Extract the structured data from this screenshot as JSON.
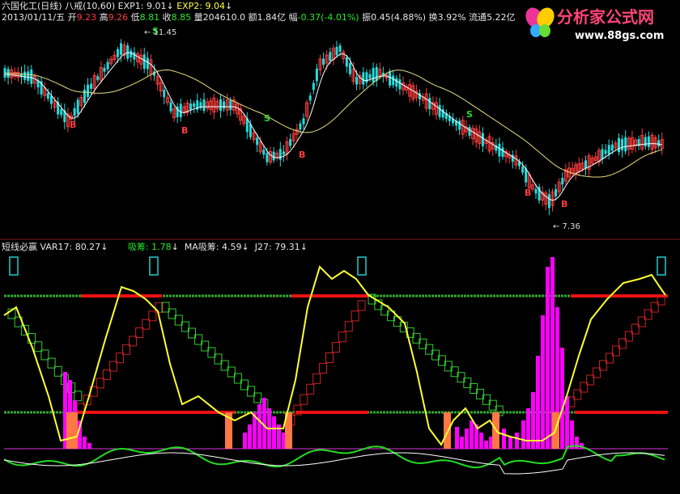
{
  "header": {
    "title": "六国化工(日线) 八戒(10,60)",
    "exp1_label": "EXP1: 9.01",
    "exp2_label": "EXP2: 9.04",
    "date": "2013/01/11/五",
    "open_label": "开",
    "open": "9.23",
    "high_label": "高",
    "high": "9.26",
    "low_label": "低",
    "low": "8.81",
    "close_label": "收",
    "close": "8.85",
    "vol_label": "量",
    "vol": "204610.0",
    "amount_label": "额",
    "amount": "1.84亿",
    "change_label": "幅",
    "change": "-0.37(-4.01%)",
    "amp_label": "振",
    "amp": "0.45(4.88%)",
    "turnover_label": "换",
    "turnover": "3.92%",
    "float_label": "流通",
    "float": "5.22亿"
  },
  "indicator": {
    "name": "短线必赢",
    "var17": "VAR17: 80.27",
    "xichou": "吸筹: 1.78",
    "ma_xichou": "MA吸筹: 4.59",
    "j27": "J27: 79.31"
  },
  "annotations": {
    "high_price": "11.45",
    "low_price": "7.36",
    "buy": "B",
    "sell": "S"
  },
  "watermark": {
    "text": "分析家公式网",
    "url": "www.88gs.com"
  },
  "colors": {
    "up": "#ff3c3c",
    "down": "#22dddd",
    "ma_short": "#ffffff",
    "ma_long": "#e8e080",
    "yellow_line": "#ffff33",
    "magenta": "#ff00ff",
    "orange": "#ff7744",
    "green": "#22dd22"
  }
}
